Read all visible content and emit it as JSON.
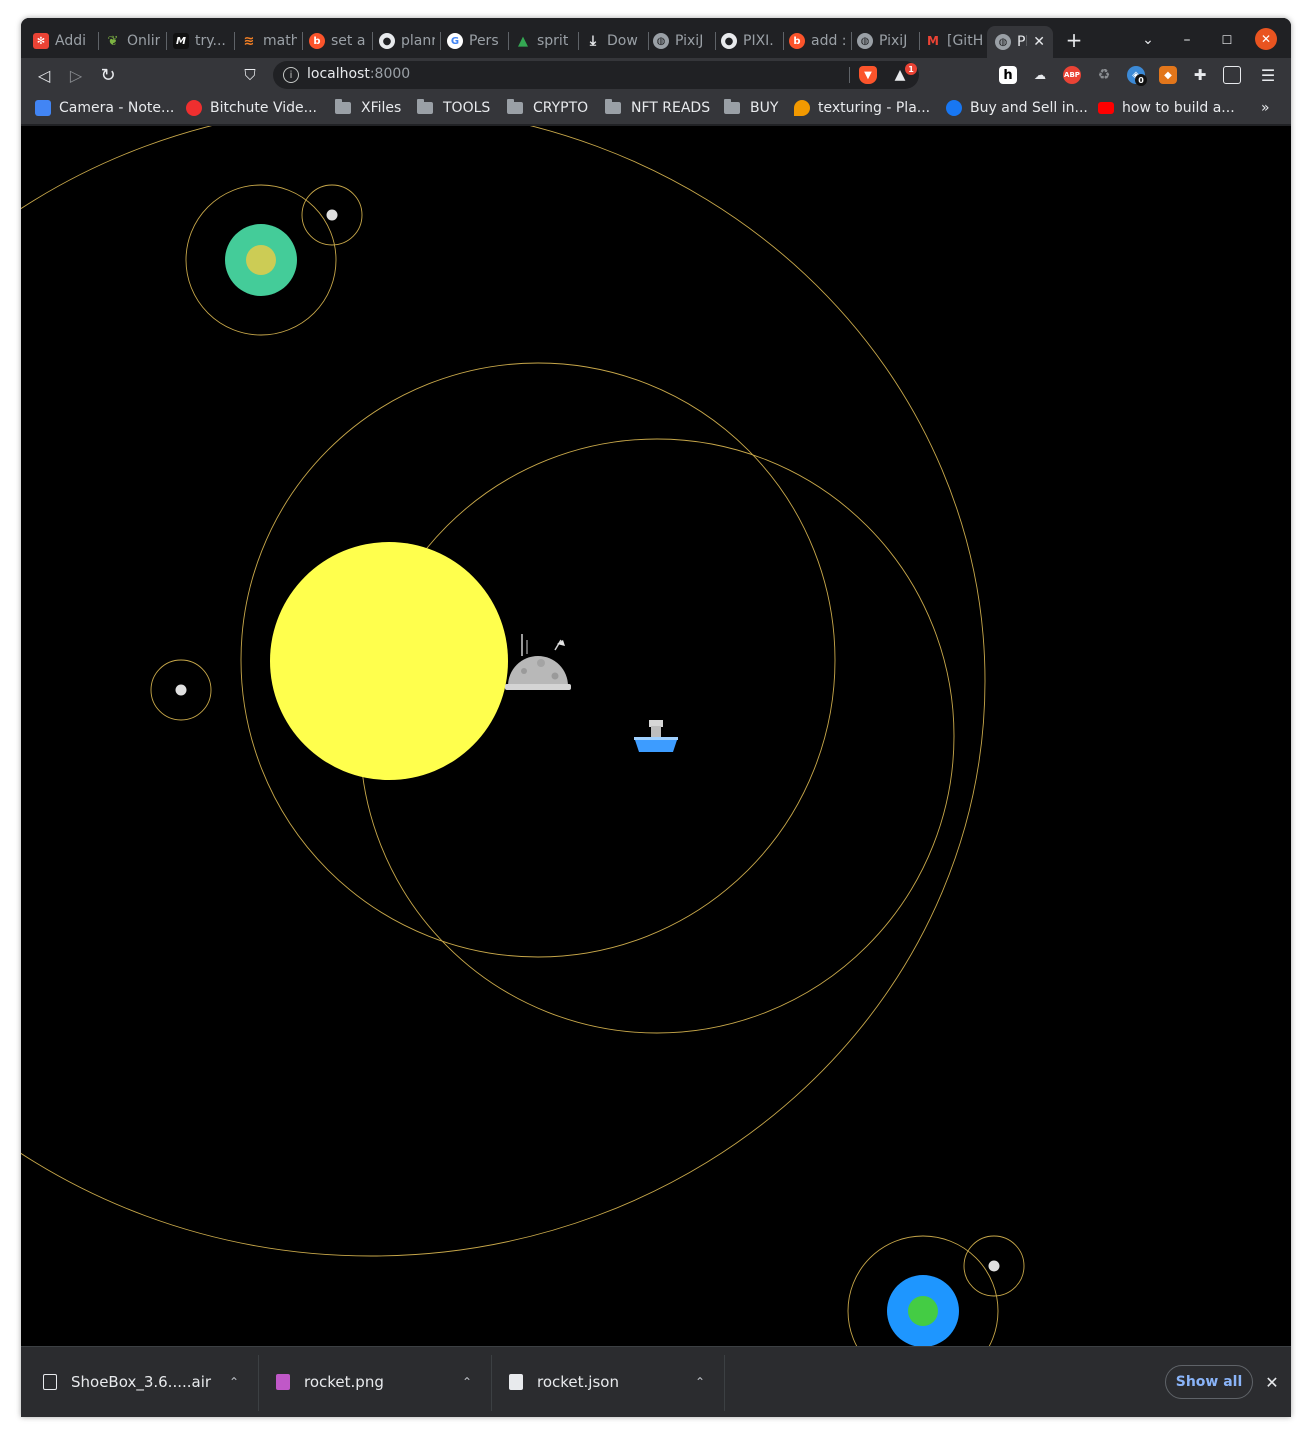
{
  "tabs": [
    {
      "title": "Addi",
      "icon": "firebase-icon",
      "color": "#ea4335"
    },
    {
      "title": "Onlir",
      "icon": "leaf-icon",
      "color": "#7cb342"
    },
    {
      "title": "try...",
      "icon": "m-logo-icon",
      "color": "#111111"
    },
    {
      "title": "math",
      "icon": "stackoverflow-icon",
      "color": "#f48024"
    },
    {
      "title": "set a",
      "icon": "brave-search-icon",
      "color": "#fb542b"
    },
    {
      "title": "planr",
      "icon": "github-icon",
      "color": "#e8eaed"
    },
    {
      "title": "Pers",
      "icon": "google-icon",
      "color": "#4285f4"
    },
    {
      "title": "sprit",
      "icon": "google-drive-icon",
      "color": "#34a853"
    },
    {
      "title": "Dow",
      "icon": "download-icon",
      "color": "#e8eaed"
    },
    {
      "title": "PixiJ",
      "icon": "globe-icon",
      "color": "#9aa0a6"
    },
    {
      "title": "PIXI.",
      "icon": "github-icon",
      "color": "#e8eaed"
    },
    {
      "title": "add :",
      "icon": "brave-search-icon",
      "color": "#fb542b"
    },
    {
      "title": "PixiJ",
      "icon": "globe-icon",
      "color": "#9aa0a6"
    },
    {
      "title": "[GitH",
      "icon": "gmail-icon",
      "color": "#ea4335"
    }
  ],
  "active_tab": {
    "title": "Pl",
    "icon": "globe-icon"
  },
  "new_tab_label": "+",
  "toolbar": {
    "url_host": "localhost",
    "url_port": ":8000",
    "brave_badge": "1",
    "wallet_badge": "0"
  },
  "bookmarks": [
    {
      "label": "Camera - Note...",
      "icon": "puzzle-icon",
      "color": "#4285f4",
      "type": "site"
    },
    {
      "label": "Bitchute Vide...",
      "icon": "bitchute-icon",
      "color": "#ef2f2f",
      "type": "site"
    },
    {
      "label": "XFiles",
      "icon": "folder-icon",
      "type": "folder"
    },
    {
      "label": "TOOLS",
      "icon": "folder-icon",
      "type": "folder"
    },
    {
      "label": "CRYPTO",
      "icon": "folder-icon",
      "type": "folder"
    },
    {
      "label": "NFT READS",
      "icon": "folder-icon",
      "type": "folder"
    },
    {
      "label": "BUY",
      "icon": "folder-icon",
      "type": "folder"
    },
    {
      "label": "texturing - Pla...",
      "icon": "location-pin-icon",
      "color": "#f29900",
      "type": "site"
    },
    {
      "label": "Buy and Sell in...",
      "icon": "facebook-icon",
      "color": "#1877f2",
      "type": "site"
    },
    {
      "label": "how to build a...",
      "icon": "youtube-icon",
      "color": "#ff0000",
      "type": "site"
    }
  ],
  "bookmarks_overflow": "»",
  "scene": {
    "background": "#000000",
    "orbit_color": "#c8a84a",
    "sun_color": "#ffff4d",
    "planet_teal_outer": "#44cc99",
    "planet_teal_inner": "#cccc55",
    "planet_blue_outer": "#1e96ff",
    "planet_blue_inner": "#44cc44",
    "moon_color": "#e0e0e0",
    "station_color": "#b8b8b8",
    "ship_hull_color": "#3d9cff"
  },
  "downloads": [
    {
      "name": "ShoeBox_3.6.....air",
      "icon": "archive-file-icon",
      "color": "#e8eaed"
    },
    {
      "name": "rocket.png",
      "icon": "image-file-icon",
      "color": "#c058c8"
    },
    {
      "name": "rocket.json",
      "icon": "json-file-icon",
      "color": "#e8eaed"
    }
  ],
  "show_all_label": "Show all",
  "chevron_up": "⌃",
  "close_label": "✕"
}
